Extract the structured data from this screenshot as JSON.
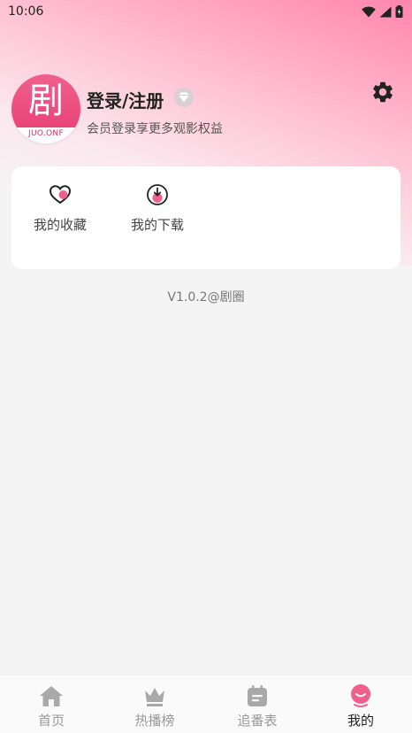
{
  "status_bar": {
    "time": "10:06"
  },
  "profile": {
    "avatar_char": "剧",
    "avatar_text": "JUO.ONF",
    "login_title": "登录/注册",
    "login_subtitle": "会员登录享更多观影权益"
  },
  "quick_actions": [
    {
      "label": "我的收藏",
      "icon": "heart-icon"
    },
    {
      "label": "我的下载",
      "icon": "download-icon"
    }
  ],
  "version": "V1.0.2@剧圈",
  "tabbar": {
    "tabs": [
      {
        "label": "首页",
        "icon": "home-icon",
        "active": false
      },
      {
        "label": "热播榜",
        "icon": "crown-icon",
        "active": false
      },
      {
        "label": "追番表",
        "icon": "calendar-icon",
        "active": false
      },
      {
        "label": "我的",
        "icon": "profile-icon",
        "active": true
      }
    ]
  },
  "colors": {
    "accent": "#f0608c",
    "inactive": "#999999"
  }
}
